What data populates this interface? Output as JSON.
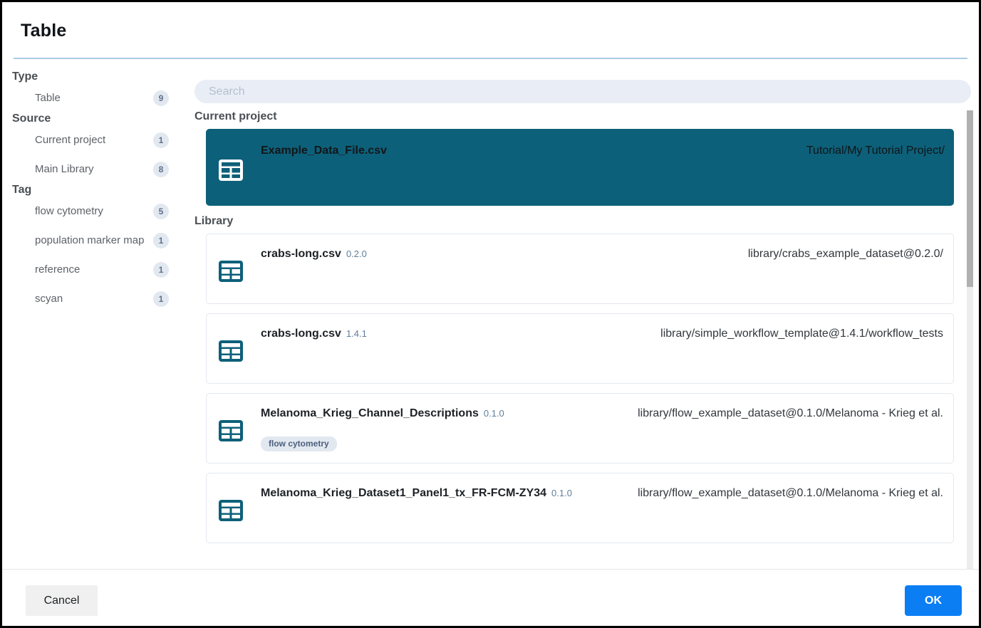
{
  "window": {
    "title": "Table"
  },
  "search": {
    "placeholder": "Search",
    "value": ""
  },
  "facets": [
    {
      "group": "Type",
      "items": [
        {
          "label": "Table",
          "count": "9"
        }
      ]
    },
    {
      "group": "Source",
      "items": [
        {
          "label": "Current project",
          "count": "1"
        },
        {
          "label": "Main Library",
          "count": "8"
        }
      ]
    },
    {
      "group": "Tag",
      "items": [
        {
          "label": "flow cytometry",
          "count": "5"
        },
        {
          "label": "population marker map",
          "count": "1"
        },
        {
          "label": "reference",
          "count": "1"
        },
        {
          "label": "scyan",
          "count": "1"
        }
      ]
    }
  ],
  "sections": [
    {
      "title": "Current project",
      "items": [
        {
          "name": "Example_Data_File.csv",
          "version": "",
          "path": "Tutorial/My Tutorial Project/",
          "icon": "table-icon",
          "tags": [],
          "selected": true
        }
      ]
    },
    {
      "title": "Library",
      "items": [
        {
          "name": "crabs-long.csv",
          "version": "0.2.0",
          "path": "library/crabs_example_dataset@0.2.0/",
          "icon": "table-icon",
          "tags": [],
          "selected": false
        },
        {
          "name": "crabs-long.csv",
          "version": "1.4.1",
          "path": "library/simple_workflow_template@1.4.1/workflow_tests",
          "icon": "table-icon",
          "tags": [],
          "selected": false
        },
        {
          "name": "Melanoma_Krieg_Channel_Descriptions",
          "version": "0.1.0",
          "path": "library/flow_example_dataset@0.1.0/Melanoma - Krieg et al.",
          "icon": "table-icon",
          "tags": [
            "flow cytometry"
          ],
          "selected": false
        },
        {
          "name": "Melanoma_Krieg_Dataset1_Panel1_tx_FR-FCM-ZY34",
          "version": "0.1.0",
          "path": "library/flow_example_dataset@0.1.0/Melanoma - Krieg et al.",
          "icon": "table-icon",
          "tags": [],
          "selected": false
        }
      ]
    }
  ],
  "footer": {
    "cancel_label": "Cancel",
    "ok_label": "OK"
  },
  "colors": {
    "selected_row": "#0d6079",
    "icon_teal": "#0d6079",
    "primary_button": "#0b7ef4",
    "divider": "#a9cde4",
    "badge_bg": "#e2e8f0",
    "search_bg": "#e9eef6"
  }
}
